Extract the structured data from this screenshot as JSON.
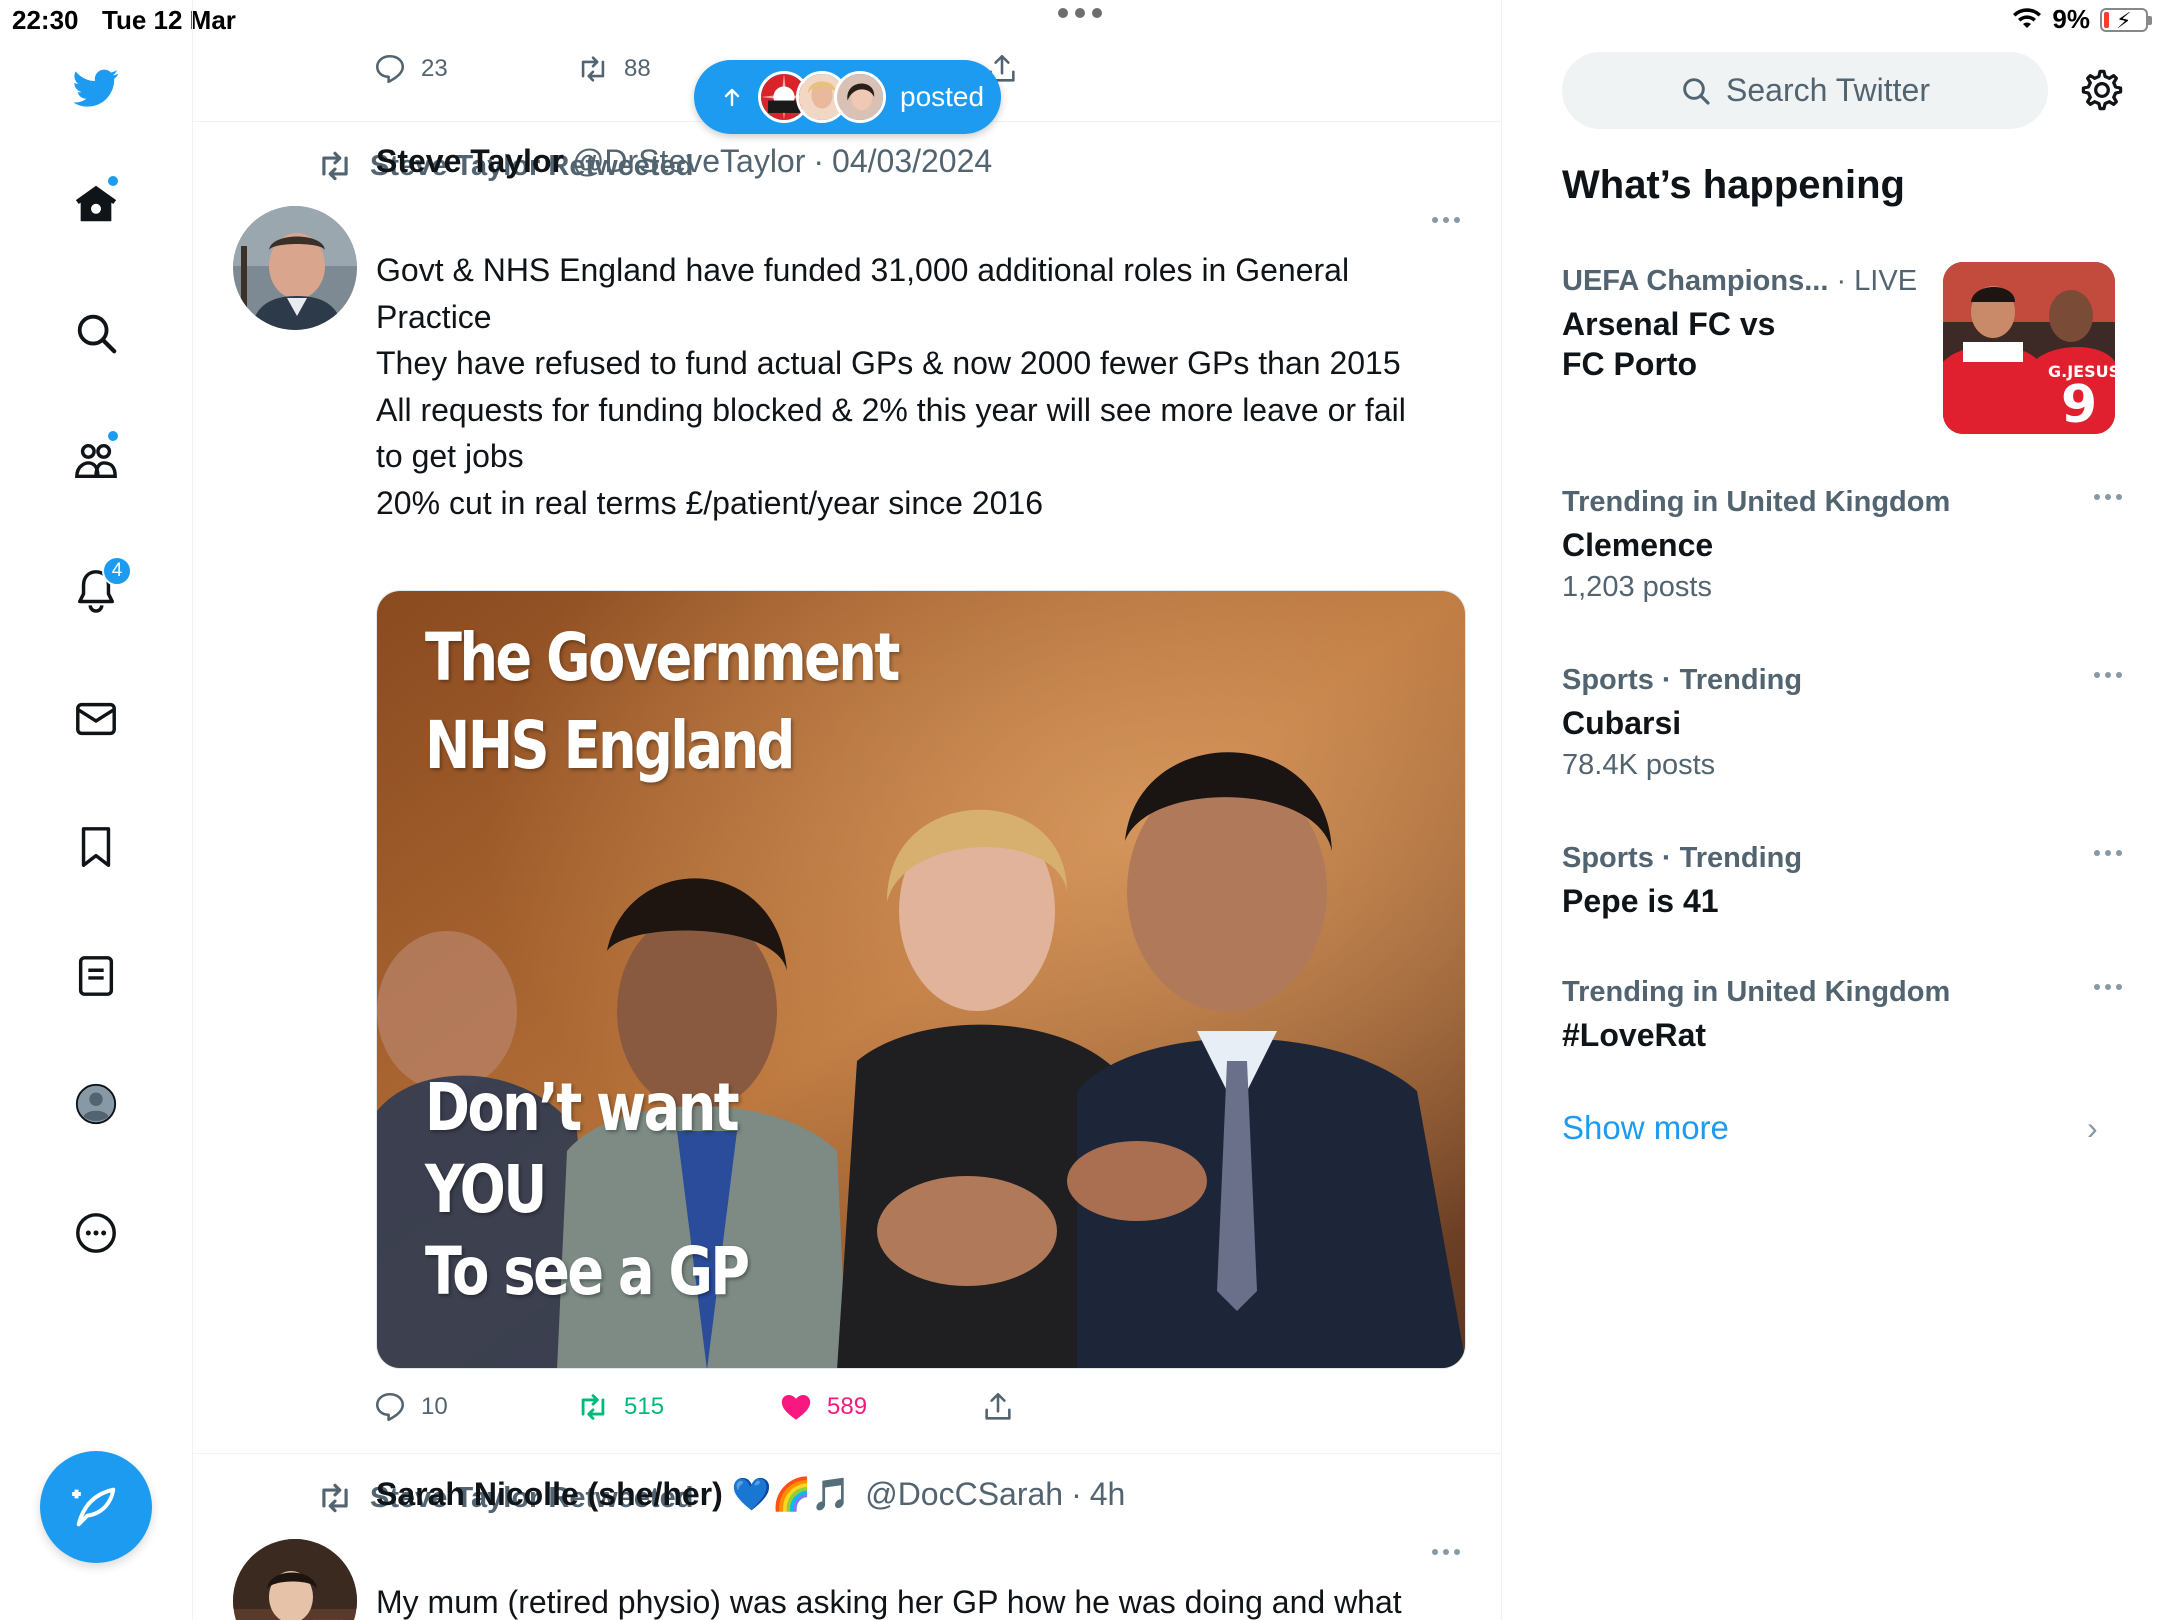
{
  "status_bar": {
    "time": "22:30",
    "date": "Tue 12 Mar",
    "battery": "9%"
  },
  "nav": {
    "notifications_count": "4"
  },
  "top_tweet_actions": {
    "replies": "23",
    "retweets": "88"
  },
  "posted_pill": {
    "label": "posted"
  },
  "tweet1": {
    "retweeted_by": "Steve Taylor Retweeted",
    "name": "Steve Taylor",
    "handle": "@DrSteveTaylor",
    "sep": "·",
    "date": "04/03/2024",
    "lines": [
      "Govt & NHS England have funded 31,000 additional roles in General Practice",
      "They have refused to fund actual GPs & now 2000 fewer GPs than 2015",
      "All requests for funding blocked & 2% this year will see more leave or fail to get jobs",
      "20% cut in real terms £/patient/year since 2016"
    ],
    "media_text": {
      "line1": "The Government",
      "line2": "NHS England",
      "line3": "Don’t want",
      "line4": "YOU",
      "line5": "To see a GP"
    },
    "replies": "10",
    "retweets": "515",
    "likes": "589"
  },
  "tweet2": {
    "retweeted_by": "Steve Taylor Retweeted",
    "name": "Sarah Nicolle (she/her) 💙🌈🎵",
    "handle": "@DocCSarah",
    "sep": "·",
    "time": "4h",
    "text": "My mum (retired physio) was asking her GP how he was doing and what"
  },
  "search": {
    "placeholder": "Search Twitter"
  },
  "whats_happening": {
    "title": "What’s happening",
    "trends": [
      {
        "context": "UEFA Champions...",
        "live": " · LIVE",
        "name": "Arsenal FC vs FC Porto",
        "count": ""
      },
      {
        "context": "Trending in United Kingdom",
        "name": "Clemence",
        "count": "1,203 posts"
      },
      {
        "context": "Sports · Trending",
        "name": "Cubarsi",
        "count": "78.4K posts"
      },
      {
        "context": "Sports · Trending",
        "name": "Pepe is 41",
        "count": ""
      },
      {
        "context": "Trending in United Kingdom",
        "name": "#LoveRat",
        "count": ""
      }
    ],
    "show_more": "Show more"
  },
  "colors": {
    "accent": "#1d9bf0",
    "retweet": "#00ba7c",
    "like": "#f91880",
    "muted": "#536471"
  }
}
